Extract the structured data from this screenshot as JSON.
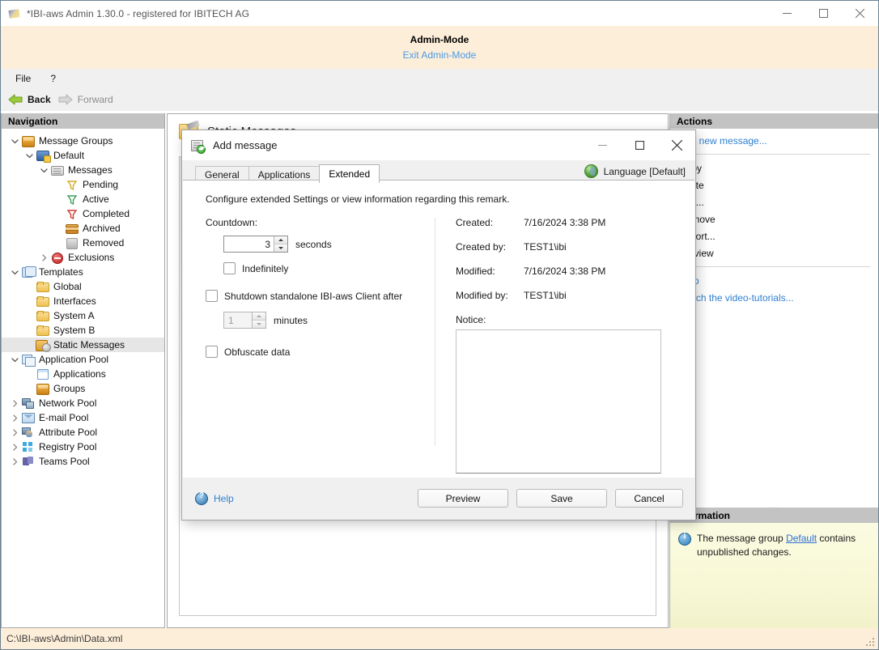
{
  "window": {
    "title": "*IBI-aws Admin 1.30.0 - registered for IBITECH AG",
    "minimize_label": "Minimize",
    "maximize_label": "Maximize",
    "close_label": "Close"
  },
  "admin_banner": {
    "title": "Admin-Mode",
    "exit_link": "Exit Admin-Mode"
  },
  "menubar": {
    "items": [
      {
        "label": "File"
      },
      {
        "label": "?"
      }
    ]
  },
  "navtoolbar": {
    "back": "Back",
    "forward": "Forward"
  },
  "navigation": {
    "header": "Navigation",
    "items": [
      {
        "label": "Message Groups",
        "indent": 0,
        "twisty": "down",
        "icon": "box-icon"
      },
      {
        "label": "Default",
        "indent": 1,
        "twisty": "down",
        "icon": "monitor-warning-icon"
      },
      {
        "label": "Messages",
        "indent": 2,
        "twisty": "down",
        "icon": "message-icon"
      },
      {
        "label": "Pending",
        "indent": 3,
        "twisty": "none",
        "icon": "funnel-yellow-icon"
      },
      {
        "label": "Active",
        "indent": 3,
        "twisty": "none",
        "icon": "funnel-green-icon"
      },
      {
        "label": "Completed",
        "indent": 3,
        "twisty": "none",
        "icon": "funnel-red-icon"
      },
      {
        "label": "Archived",
        "indent": 3,
        "twisty": "none",
        "icon": "archive-icon"
      },
      {
        "label": "Removed",
        "indent": 3,
        "twisty": "none",
        "icon": "removed-icon"
      },
      {
        "label": "Exclusions",
        "indent": 2,
        "twisty": "right",
        "icon": "stop-icon"
      },
      {
        "label": "Templates",
        "indent": 0,
        "twisty": "down",
        "icon": "templates-icon"
      },
      {
        "label": "Global",
        "indent": 1,
        "twisty": "none",
        "icon": "folder-icon"
      },
      {
        "label": "Interfaces",
        "indent": 1,
        "twisty": "none",
        "icon": "folder-icon"
      },
      {
        "label": "System A",
        "indent": 1,
        "twisty": "none",
        "icon": "folder-icon"
      },
      {
        "label": "System B",
        "indent": 1,
        "twisty": "none",
        "icon": "folder-icon"
      },
      {
        "label": "Static Messages",
        "indent": 1,
        "twisty": "none",
        "icon": "static-messages-icon",
        "selected": true
      },
      {
        "label": "Application Pool",
        "indent": 0,
        "twisty": "down",
        "icon": "app-pool-icon"
      },
      {
        "label": "Applications",
        "indent": 1,
        "twisty": "none",
        "icon": "application-icon"
      },
      {
        "label": "Groups",
        "indent": 1,
        "twisty": "none",
        "icon": "box-icon"
      },
      {
        "label": "Network Pool",
        "indent": 0,
        "twisty": "right",
        "icon": "network-icon"
      },
      {
        "label": "E-mail Pool",
        "indent": 0,
        "twisty": "right",
        "icon": "email-icon"
      },
      {
        "label": "Attribute Pool",
        "indent": 0,
        "twisty": "right",
        "icon": "attribute-icon"
      },
      {
        "label": "Registry Pool",
        "indent": 0,
        "twisty": "right",
        "icon": "registry-icon"
      },
      {
        "label": "Teams Pool",
        "indent": 0,
        "twisty": "right",
        "icon": "teams-icon"
      }
    ]
  },
  "content": {
    "title": "Static Messages"
  },
  "actions": {
    "header": "Actions",
    "groups": [
      {
        "items": [
          {
            "label": "Add new message...",
            "style": "link"
          }
        ]
      },
      {
        "items": [
          {
            "label": "Copy",
            "style": "plain"
          },
          {
            "label": "Paste",
            "style": "plain"
          },
          {
            "label": "Edit...",
            "style": "plain"
          },
          {
            "label": "Remove",
            "style": "plain"
          },
          {
            "label": "Export...",
            "style": "plain"
          },
          {
            "label": "Preview",
            "style": "plain"
          }
        ]
      },
      {
        "items": [
          {
            "label": "Help",
            "style": "link"
          },
          {
            "label": "Watch the video-tutorials...",
            "style": "link"
          }
        ]
      }
    ],
    "splitter_dots": "..."
  },
  "information": {
    "header": "Information",
    "text_before": "The message group ",
    "link": "Default",
    "text_after": " contains unpublished changes."
  },
  "statusbar": {
    "path": "C:\\IBI-aws\\Admin\\Data.xml"
  },
  "dialog": {
    "title": "Add message",
    "minimize_label": "Minimize",
    "maximize_label": "Maximize",
    "close_label": "Close",
    "tabs": [
      {
        "label": "General",
        "active": false
      },
      {
        "label": "Applications",
        "active": false
      },
      {
        "label": "Extended",
        "active": true
      }
    ],
    "language_label": "Language [Default]",
    "description": "Configure extended Settings or view information regarding this remark.",
    "countdown": {
      "label": "Countdown:",
      "value": "3",
      "unit": "seconds",
      "indefinitely_label": "Indefinitely",
      "indefinitely_checked": false
    },
    "shutdown": {
      "label": "Shutdown standalone IBI-aws Client after",
      "checked": false,
      "value": "1",
      "unit": "minutes",
      "disabled": true
    },
    "obfuscate": {
      "label": "Obfuscate data",
      "checked": false
    },
    "meta": [
      {
        "key": "Created:",
        "value": "7/16/2024 3:38 PM"
      },
      {
        "key": "Created by:",
        "value": "TEST1\\ibi"
      },
      {
        "key": "Modified:",
        "value": "7/16/2024 3:38 PM"
      },
      {
        "key": "Modified by:",
        "value": "TEST1\\ibi"
      }
    ],
    "notice": {
      "label": "Notice:",
      "value": "",
      "placeholder": ""
    },
    "footer": {
      "help": "Help",
      "preview": "Preview",
      "save": "Save",
      "cancel": "Cancel"
    }
  },
  "colors": {
    "banner_bg": "#fdeed9",
    "link": "#2f7fd0",
    "admin_link": "#4a9ae8",
    "panel_header": "#c3c3c3",
    "info_bg": "#faf9d8"
  }
}
